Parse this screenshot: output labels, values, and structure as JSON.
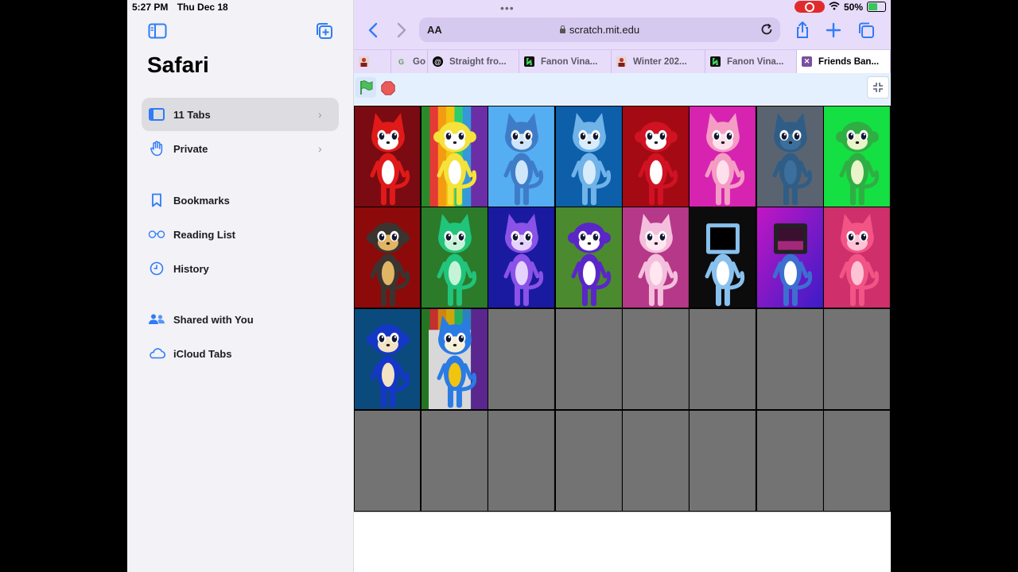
{
  "status": {
    "time": "5:27 PM",
    "date": "Thu Dec 18",
    "battery": "50%"
  },
  "sidebar": {
    "title": "Safari",
    "items": [
      {
        "label": "11 Tabs",
        "icon": "tabs-icon",
        "chevron": true,
        "active": true
      },
      {
        "label": "Private",
        "icon": "hand-icon",
        "chevron": true
      },
      {
        "label": "Bookmarks",
        "icon": "bookmark-icon"
      },
      {
        "label": "Reading List",
        "icon": "glasses-icon"
      },
      {
        "label": "History",
        "icon": "clock-icon"
      },
      {
        "label": "Shared with You",
        "icon": "shared-people-icon"
      },
      {
        "label": "iCloud Tabs",
        "icon": "cloud-icon"
      }
    ]
  },
  "toolbar": {
    "aa_label": "AA",
    "url": "scratch.mit.edu"
  },
  "tabs": [
    {
      "title": "",
      "favicon_color": "#d9534f"
    },
    {
      "title": "Go",
      "favicon_color": "#dfe3e8"
    },
    {
      "title": "Straight fro...",
      "favicon_color": "#000000"
    },
    {
      "title": "Fanon Vina...",
      "favicon_color": "#111111"
    },
    {
      "title": "Winter 202...",
      "favicon_color": "#c0392b"
    },
    {
      "title": "Fanon Vina...",
      "favicon_color": "#111111"
    },
    {
      "title": "Friends Ban...",
      "favicon_color": "#7b4fa0",
      "active": true
    }
  ],
  "stage": {
    "colors": {
      "accent": "#2f7cf6",
      "topbar": "#e8dcfb",
      "green_flag": "#4cbf56",
      "stop": "#ec5959",
      "empty_cell": "#737373"
    },
    "cells": [
      {
        "bg": "#7a0b12",
        "char": "#e01919",
        "ears": "pointed",
        "belly": "#ffffff"
      },
      {
        "bg": "rainbow",
        "char": "#f5e23a",
        "ears": "round",
        "belly": "#ffffff"
      },
      {
        "bg": "#55aef1",
        "char": "#3f7cc8",
        "ears": "pointed",
        "belly": "#cfe5fb"
      },
      {
        "bg": "#0d5faa",
        "char": "#6fb3e8",
        "ears": "pointed",
        "belly": "#d9ecfb"
      },
      {
        "bg": "#a30a14",
        "char": "#d01223",
        "ears": "round",
        "belly": "#ffffff"
      },
      {
        "bg": "#d624b0",
        "char": "#f59cc4",
        "ears": "pointed",
        "belly": "#fde0ec"
      },
      {
        "bg": "#5a6470",
        "char": "#2f5d86",
        "ears": "pointed",
        "belly": "#3d6f9c"
      },
      {
        "bg": "#14e043",
        "char": "#2fae43",
        "ears": "round",
        "belly": "#e9f5c8"
      },
      {
        "bg": "#8d0a0a",
        "char": "#3a3430",
        "ears": "round",
        "belly": "#e2b565"
      },
      {
        "bg": "#2b7b2b",
        "char": "#21c47b",
        "ears": "pointed",
        "belly": "#c5f3d7"
      },
      {
        "bg": "#1a1aa0",
        "char": "#8a52e6",
        "ears": "pointed",
        "belly": "#e5d2ff"
      },
      {
        "bg": "#4b8a2e",
        "char": "#5a26c8",
        "ears": "round",
        "belly": "#ffffff"
      },
      {
        "bg": "#b63888",
        "char": "#f4bfdc",
        "ears": "pointed",
        "belly": "#ffe6f1"
      },
      {
        "bg": "#0c0c0c",
        "char": "#88c1ee",
        "ears": "tv",
        "belly": "#ffffff"
      },
      {
        "bg": "purple-gradient",
        "char": "#3c6fd0",
        "ears": "tv-dark",
        "belly": "#ffffff"
      },
      {
        "bg": "#cf2f6a",
        "char": "#f25486",
        "ears": "pointed",
        "belly": "#ffc3d6"
      },
      {
        "bg": "#0b4a7c",
        "char": "#1437c8",
        "ears": "round",
        "belly": "#f3e2c3"
      },
      {
        "bg": "rainbow-2",
        "char": "#2a7be4",
        "ears": "pointed",
        "belly": "rainbow"
      },
      {
        "bg": "empty"
      },
      {
        "bg": "empty"
      },
      {
        "bg": "empty"
      },
      {
        "bg": "empty"
      },
      {
        "bg": "empty"
      },
      {
        "bg": "empty"
      },
      {
        "bg": "empty"
      },
      {
        "bg": "empty"
      },
      {
        "bg": "empty"
      },
      {
        "bg": "empty"
      },
      {
        "bg": "empty"
      },
      {
        "bg": "empty"
      },
      {
        "bg": "empty"
      },
      {
        "bg": "empty"
      }
    ]
  }
}
